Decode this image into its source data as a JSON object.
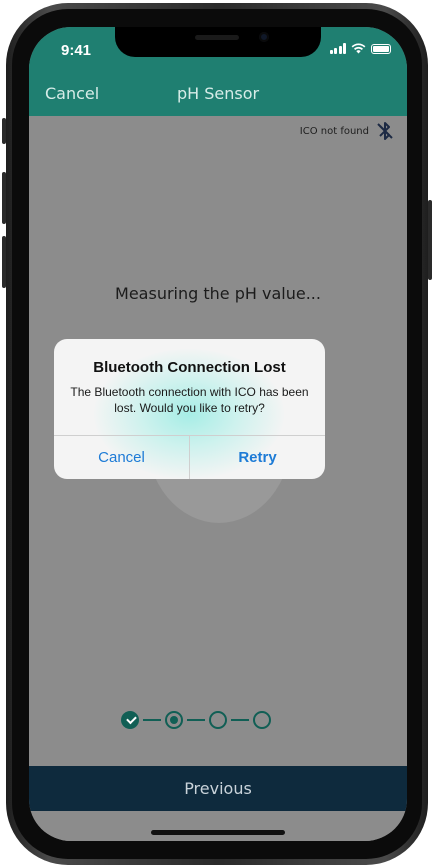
{
  "status_bar": {
    "time": "9:41"
  },
  "nav": {
    "cancel_label": "Cancel",
    "title": "pH Sensor"
  },
  "device_status": {
    "text": "ICO not found",
    "icon": "bluetooth-disconnected-icon"
  },
  "main": {
    "measuring_text": "Measuring the pH value..."
  },
  "stepper": {
    "total_steps": 4,
    "completed_steps": 1,
    "current_step": 2
  },
  "footer": {
    "previous_label": "Previous"
  },
  "alert": {
    "title": "Bluetooth Connection Lost",
    "message": "The Bluetooth connection with ICO has been lost. Would you like to retry?",
    "cancel_label": "Cancel",
    "retry_label": "Retry"
  },
  "colors": {
    "header": "#1f7f71",
    "step_accent": "#115f55",
    "footer": "#0e2a3d",
    "alert_button": "#1d7bd6"
  }
}
